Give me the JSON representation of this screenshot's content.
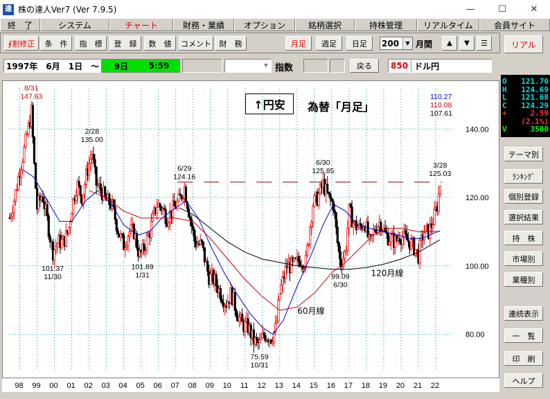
{
  "window": {
    "title": "株の達人Ver7 (Ver 7.9.5)",
    "app_icon_char": "達",
    "minimize": "—",
    "maximize": "☐",
    "close": "✕"
  },
  "menu": [
    {
      "label": "終　了",
      "active": false
    },
    {
      "label": "システム",
      "active": false
    },
    {
      "label": "チャート",
      "active": true
    },
    {
      "label": "財務・業績",
      "active": false
    },
    {
      "label": "オプション",
      "active": false
    },
    {
      "label": "銘柄選択",
      "active": false
    },
    {
      "label": "持株管理",
      "active": false
    },
    {
      "label": "リアルタイム",
      "active": false
    },
    {
      "label": "会員サイト",
      "active": false
    }
  ],
  "toolbar": {
    "split_fix": "∮割修正",
    "condition": "条　件",
    "indicator": "指　標",
    "register": "登　録",
    "value": "数　値",
    "comment": "コメント",
    "finance": "財　務",
    "monthly": "月足",
    "weekly": "週足",
    "daily": "日足",
    "count": "200",
    "period_label": "月間",
    "up_icon": "▲",
    "down_icon": "▼",
    "menu_icon": "☰"
  },
  "infobar": {
    "start_date": "1997年　6月　1日　～",
    "green_day": "9日",
    "green_time": "5:59",
    "index_label": "指数",
    "back": "戻る",
    "code": "850",
    "name": "ドル円"
  },
  "side": {
    "real": "リアル",
    "theme": "テーマ別",
    "ranking": "ﾗﾝｷﾝｸﾞ",
    "individual": "個別登録",
    "selection_result": "選択結果",
    "holdings": "持　株",
    "market": "市場別",
    "industry": "業種別",
    "continuous": "連続表示",
    "list": "一　覧",
    "print": "印　刷",
    "help": "ヘルプ"
  },
  "ohlc": [
    {
      "k": "O",
      "v": "121.70",
      "color": "#00e0e0"
    },
    {
      "k": "H",
      "v": "124.69",
      "color": "#00e0e0"
    },
    {
      "k": "L",
      "v": "121.68",
      "color": "#00e0e0"
    },
    {
      "k": "C",
      "v": "124.29",
      "color": "#00e0e0"
    },
    {
      "k": "+",
      "v": "2.59",
      "color": "#ff3030"
    },
    {
      "k": "",
      "v": "(2.1%)",
      "color": "#ff3030"
    },
    {
      "k": "V",
      "v": "3500",
      "color": "#00ff00"
    }
  ],
  "chart_data": {
    "type": "candlestick",
    "title": "為替「月足」",
    "direction_label": "↑円安",
    "x_ticks": [
      "98",
      "99",
      "00",
      "01",
      "02",
      "03",
      "04",
      "05",
      "06",
      "07",
      "08",
      "09",
      "10",
      "11",
      "12",
      "13",
      "14",
      "15",
      "16",
      "17",
      "18",
      "19",
      "20",
      "21",
      "22"
    ],
    "y_ticks": [
      "140.00",
      "120.00",
      "100.00",
      "80.00"
    ],
    "ylim": [
      70,
      152
    ],
    "ma_values": [
      {
        "value": "110.27",
        "color": "#0000cc"
      },
      {
        "value": "110.08",
        "color": "#cc0000"
      },
      {
        "value": "107.61",
        "color": "#000000"
      }
    ],
    "resistance_level": 124.5,
    "annotations": [
      {
        "date": "8/31",
        "price": "147.63",
        "x": 1998.67,
        "y": 147.63,
        "pos": "top",
        "color": "#cc0000"
      },
      {
        "date": "2/28",
        "price": "135.00",
        "x": 2002.17,
        "y": 135.0,
        "pos": "top",
        "color": "#000000"
      },
      {
        "date": "6/29",
        "price": "124.16",
        "x": 2007.5,
        "y": 124.16,
        "pos": "top",
        "color": "#000000"
      },
      {
        "date": "6/30",
        "price": "125.85",
        "x": 2015.5,
        "y": 125.85,
        "pos": "top",
        "color": "#000000"
      },
      {
        "date": "3/28",
        "price": "125.03",
        "x": 2022.25,
        "y": 125.03,
        "pos": "top",
        "color": "#000000"
      },
      {
        "date": "11/30",
        "price": "101.37",
        "x": 1999.9,
        "y": 101.37,
        "pos": "bottom",
        "color": "#000000"
      },
      {
        "date": "1/31",
        "price": "101.89",
        "x": 2005.08,
        "y": 101.89,
        "pos": "bottom",
        "color": "#000000"
      },
      {
        "date": "10/31",
        "price": "75.59",
        "x": 2011.83,
        "y": 75.59,
        "pos": "bottom",
        "color": "#000000"
      },
      {
        "date": "6/30",
        "price": "99.09",
        "x": 2016.5,
        "y": 99.09,
        "pos": "bottom",
        "color": "#000000"
      }
    ],
    "line_labels": [
      {
        "text": "120月線",
        "x": 2019.2,
        "y": 97.0
      },
      {
        "text": "60月線",
        "x": 2014.8,
        "y": 86.0
      }
    ],
    "price_path": [
      [
        1997.42,
        114
      ],
      [
        1997.7,
        120
      ],
      [
        1998.0,
        128
      ],
      [
        1998.3,
        135
      ],
      [
        1998.67,
        145
      ],
      [
        1998.85,
        128
      ],
      [
        1999.0,
        117
      ],
      [
        1999.3,
        121
      ],
      [
        1999.6,
        113
      ],
      [
        1999.9,
        104
      ],
      [
        2000.2,
        107
      ],
      [
        2000.5,
        107
      ],
      [
        2000.8,
        110
      ],
      [
        2001.0,
        117
      ],
      [
        2001.3,
        124
      ],
      [
        2001.6,
        120
      ],
      [
        2001.9,
        128
      ],
      [
        2002.17,
        133
      ],
      [
        2002.4,
        124
      ],
      [
        2002.7,
        122
      ],
      [
        2003.0,
        119
      ],
      [
        2003.3,
        118
      ],
      [
        2003.7,
        110
      ],
      [
        2004.0,
        106
      ],
      [
        2004.3,
        110
      ],
      [
        2004.6,
        110
      ],
      [
        2004.9,
        103
      ],
      [
        2005.08,
        104
      ],
      [
        2005.5,
        110
      ],
      [
        2005.9,
        118
      ],
      [
        2006.2,
        117
      ],
      [
        2006.5,
        114
      ],
      [
        2006.9,
        117
      ],
      [
        2007.2,
        119
      ],
      [
        2007.5,
        123
      ],
      [
        2007.8,
        115
      ],
      [
        2008.1,
        107
      ],
      [
        2008.5,
        106
      ],
      [
        2008.9,
        97
      ],
      [
        2009.2,
        96
      ],
      [
        2009.6,
        92
      ],
      [
        2009.9,
        89
      ],
      [
        2010.2,
        92
      ],
      [
        2010.5,
        87
      ],
      [
        2010.8,
        83
      ],
      [
        2011.2,
        82
      ],
      [
        2011.5,
        78
      ],
      [
        2011.83,
        77
      ],
      [
        2012.1,
        80
      ],
      [
        2012.5,
        79
      ],
      [
        2012.8,
        82
      ],
      [
        2013.0,
        92
      ],
      [
        2013.4,
        100
      ],
      [
        2013.8,
        100
      ],
      [
        2014.2,
        102
      ],
      [
        2014.5,
        101
      ],
      [
        2014.9,
        118
      ],
      [
        2015.2,
        120
      ],
      [
        2015.5,
        124
      ],
      [
        2015.8,
        120
      ],
      [
        2016.1,
        118
      ],
      [
        2016.3,
        108
      ],
      [
        2016.5,
        101
      ],
      [
        2016.8,
        104
      ],
      [
        2017.0,
        116
      ],
      [
        2017.3,
        112
      ],
      [
        2017.6,
        111
      ],
      [
        2017.9,
        113
      ],
      [
        2018.2,
        106
      ],
      [
        2018.5,
        111
      ],
      [
        2018.8,
        113
      ],
      [
        2019.1,
        109
      ],
      [
        2019.4,
        108
      ],
      [
        2019.7,
        107
      ],
      [
        2019.9,
        109
      ],
      [
        2020.2,
        108
      ],
      [
        2020.5,
        107
      ],
      [
        2020.8,
        105
      ],
      [
        2021.0,
        103
      ],
      [
        2021.3,
        110
      ],
      [
        2021.6,
        110
      ],
      [
        2021.9,
        114
      ],
      [
        2022.1,
        118
      ],
      [
        2022.25,
        124
      ]
    ],
    "ma_paths": [
      {
        "name": "blue",
        "color": "#0000cc",
        "points": [
          [
            1998.2,
            128
          ],
          [
            1998.8,
            126
          ],
          [
            1999.5,
            120
          ],
          [
            2000.3,
            113
          ],
          [
            2001.0,
            113
          ],
          [
            2001.8,
            119
          ],
          [
            2002.5,
            122
          ],
          [
            2003.3,
            118
          ],
          [
            2004.0,
            112
          ],
          [
            2004.8,
            109
          ],
          [
            2005.5,
            110
          ],
          [
            2006.2,
            114
          ],
          [
            2007.0,
            117
          ],
          [
            2007.6,
            119
          ],
          [
            2008.3,
            114
          ],
          [
            2009.0,
            106
          ],
          [
            2009.8,
            98
          ],
          [
            2010.5,
            92
          ],
          [
            2011.3,
            86
          ],
          [
            2012.0,
            82
          ],
          [
            2012.6,
            80
          ],
          [
            2013.2,
            84
          ],
          [
            2014.0,
            94
          ],
          [
            2014.8,
            103
          ],
          [
            2015.5,
            112
          ],
          [
            2016.1,
            118
          ],
          [
            2016.8,
            116
          ],
          [
            2017.5,
            112
          ],
          [
            2018.2,
            111
          ],
          [
            2019.0,
            110
          ],
          [
            2019.8,
            109
          ],
          [
            2020.5,
            108
          ],
          [
            2021.2,
            108
          ],
          [
            2022.25,
            110.27
          ]
        ]
      },
      {
        "name": "red",
        "color": "#cc0000",
        "points": [
          [
            2002.0,
            122
          ],
          [
            2003.0,
            120
          ],
          [
            2004.0,
            116
          ],
          [
            2005.0,
            114
          ],
          [
            2006.0,
            114
          ],
          [
            2007.0,
            114
          ],
          [
            2008.0,
            113
          ],
          [
            2009.0,
            108
          ],
          [
            2010.0,
            102
          ],
          [
            2011.0,
            96
          ],
          [
            2012.0,
            91
          ],
          [
            2013.0,
            87
          ],
          [
            2014.0,
            88
          ],
          [
            2015.0,
            92
          ],
          [
            2016.0,
            98
          ],
          [
            2016.8,
            101
          ],
          [
            2017.6,
            105
          ],
          [
            2018.4,
            109
          ],
          [
            2019.2,
            111
          ],
          [
            2020.0,
            111
          ],
          [
            2021.0,
            110
          ],
          [
            2022.25,
            110.08
          ]
        ]
      },
      {
        "name": "black",
        "color": "#000000",
        "points": [
          [
            2007.2,
            117
          ],
          [
            2008.0,
            115
          ],
          [
            2009.0,
            111
          ],
          [
            2010.0,
            107
          ],
          [
            2011.0,
            104
          ],
          [
            2012.0,
            102
          ],
          [
            2013.0,
            101
          ],
          [
            2014.0,
            100
          ],
          [
            2015.0,
            99.5
          ],
          [
            2016.0,
            99
          ],
          [
            2017.0,
            99
          ],
          [
            2018.0,
            99.5
          ],
          [
            2019.0,
            100.5
          ],
          [
            2020.0,
            102
          ],
          [
            2021.0,
            104
          ],
          [
            2022.25,
            107.61
          ]
        ]
      }
    ]
  }
}
